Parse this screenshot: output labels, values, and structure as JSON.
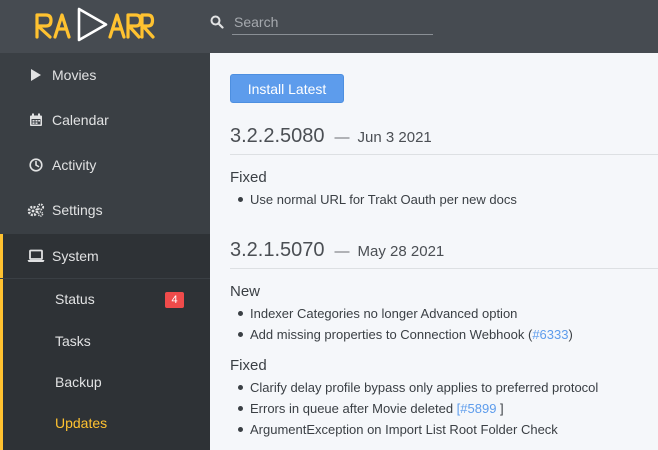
{
  "header": {
    "logo_text": "RADARR",
    "search": {
      "placeholder": "Search",
      "value": ""
    }
  },
  "sidebar": {
    "items": [
      {
        "label": "Movies",
        "icon": "play-icon"
      },
      {
        "label": "Calendar",
        "icon": "calendar-icon"
      },
      {
        "label": "Activity",
        "icon": "clock-icon"
      },
      {
        "label": "Settings",
        "icon": "gears-icon"
      },
      {
        "label": "System",
        "icon": "laptop-icon",
        "active": true
      }
    ],
    "subitems": [
      {
        "label": "Status",
        "badge": "4"
      },
      {
        "label": "Tasks"
      },
      {
        "label": "Backup"
      },
      {
        "label": "Updates",
        "selected": true
      }
    ]
  },
  "content": {
    "install_label": "Install Latest",
    "dash": "—",
    "releases": [
      {
        "version": "3.2.2.5080",
        "date": "Jun 3 2021",
        "sections": [
          {
            "title": "Fixed",
            "changes": [
              "Use normal URL for Trakt Oauth per new docs"
            ]
          }
        ]
      },
      {
        "version": "3.2.1.5070",
        "date": "May 28 2021",
        "sections": [
          {
            "title": "New",
            "changes": [
              "Indexer Categories no longer Advanced option",
              {
                "text": "Add missing properties to Connection Webhook (",
                "link": "#6333",
                "suffix": ")"
              }
            ]
          },
          {
            "title": "Fixed",
            "changes": [
              "Clarify delay profile bypass only applies to preferred protocol",
              {
                "text": "Errors in queue after Movie deleted ",
                "link": "[#5899",
                "suffix": " ]"
              },
              "ArgumentException on Import List Root Folder Check"
            ]
          }
        ]
      }
    ]
  },
  "colors": {
    "header": "#464b51",
    "sidebar": "#3a3f44",
    "accent": "#ffc230",
    "primary": "#5d9cec",
    "badge": "#f04b4b"
  }
}
